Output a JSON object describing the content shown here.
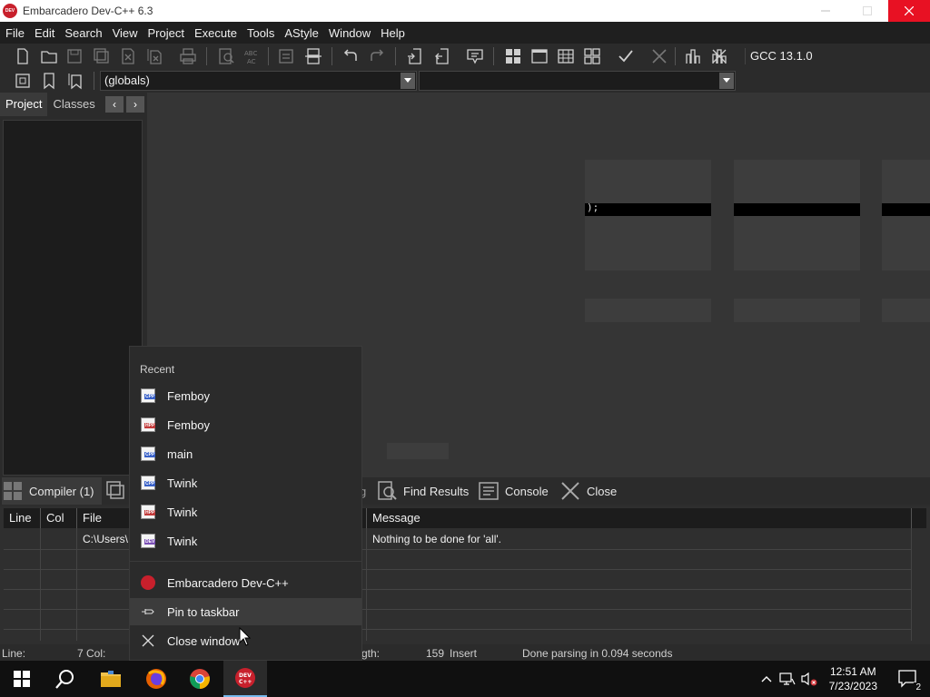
{
  "window": {
    "title": "Embarcadero Dev-C++ 6.3",
    "app_icon_text": "DEV C++"
  },
  "menu": [
    "File",
    "Edit",
    "Search",
    "View",
    "Project",
    "Execute",
    "Tools",
    "AStyle",
    "Window",
    "Help"
  ],
  "toolbar": {
    "compiler": "GCC 13.1.0",
    "scope_combo": "(globals)",
    "function_combo": ""
  },
  "left_panel": {
    "tabs": [
      "Project",
      "Classes"
    ],
    "nav_prev": "‹",
    "nav_next": "›"
  },
  "editor": {
    "ghost_code": ");"
  },
  "bottom_tabs": {
    "compiler": "Compiler (1)",
    "debug_partial": "g",
    "find_results": "Find Results",
    "console": "Console",
    "close": "Close"
  },
  "messages": {
    "columns": [
      "Line",
      "Col",
      "File",
      "Message"
    ],
    "rows": [
      {
        "line": "",
        "col": "",
        "file": "C:\\Users\\",
        "message": "Nothing to be done for 'all'."
      }
    ]
  },
  "status": {
    "line_label": "Line:",
    "col_value": "7 Col:",
    "length_partial": "gth:",
    "length_value": "159",
    "mode": "Insert",
    "parse_message": "Done parsing in 0.094 seconds"
  },
  "jumplist": {
    "header": "Recent",
    "recent": [
      {
        "label": "Femboy",
        "type": "cpp"
      },
      {
        "label": "Femboy",
        "type": "hpp"
      },
      {
        "label": "main",
        "type": "cpp"
      },
      {
        "label": "Twink",
        "type": "cpp"
      },
      {
        "label": "Twink",
        "type": "hpp"
      },
      {
        "label": "Twink",
        "type": "dev"
      }
    ],
    "app_label": "Embarcadero Dev-C++",
    "pin_label": "Pin to taskbar",
    "close_label": "Close window"
  },
  "taskbar": {
    "time": "12:51 AM",
    "date": "7/23/2023",
    "notification_count": "2"
  },
  "colors": {
    "close_red": "#e81123",
    "taskbar_accent": "#76b9ed"
  }
}
